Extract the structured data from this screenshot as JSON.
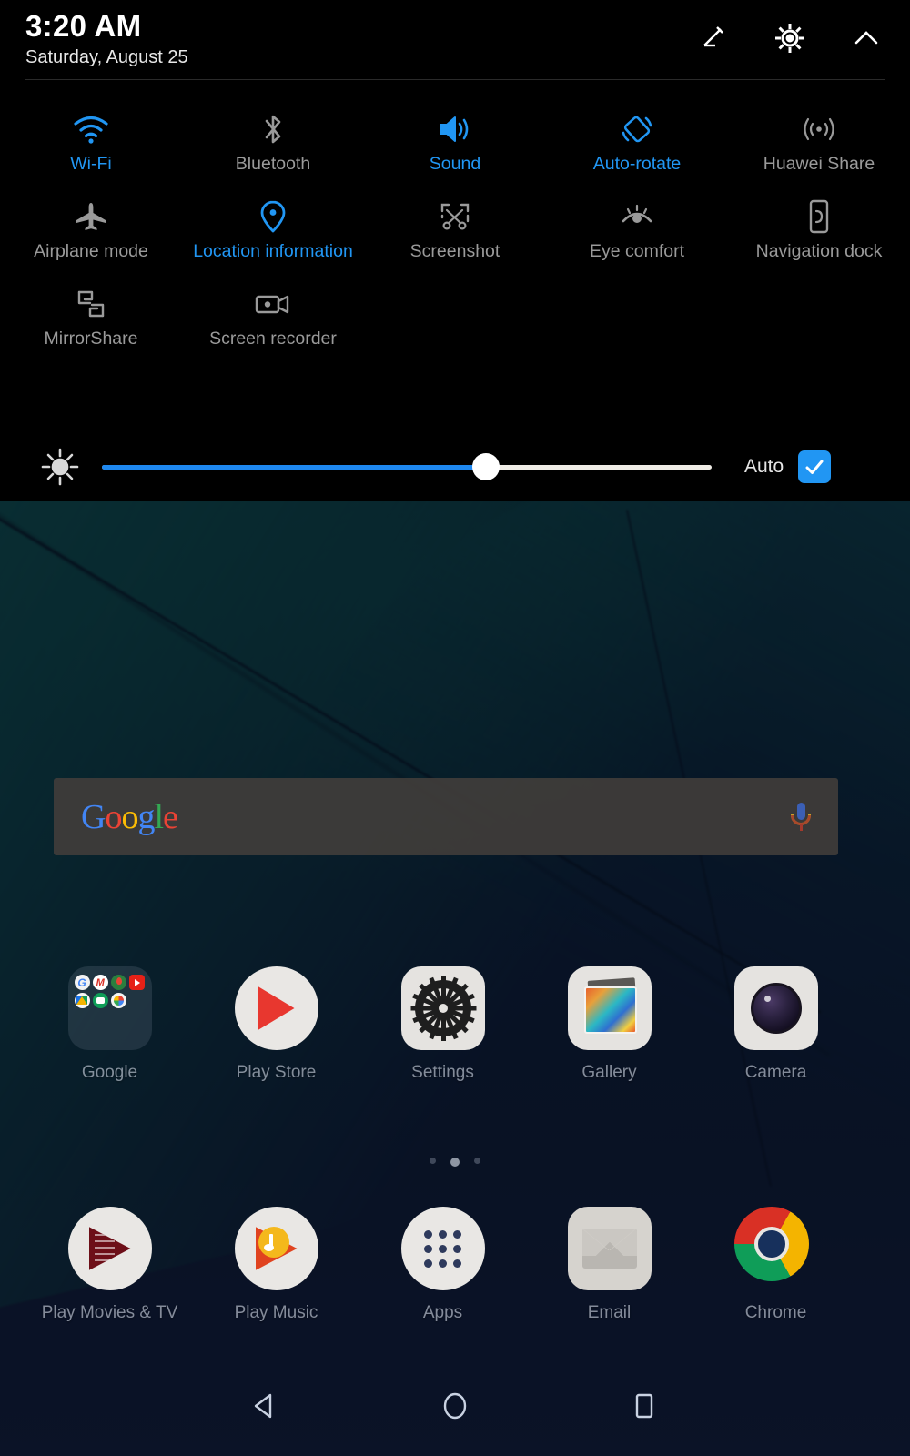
{
  "quick_settings": {
    "time": "3:20 AM",
    "date": "Saturday, August 25",
    "actions": [
      {
        "name": "edit-icon",
        "label": "Edit"
      },
      {
        "name": "settings-gear-icon",
        "label": "Settings"
      },
      {
        "name": "collapse-chevron-up-icon",
        "label": "Collapse"
      }
    ],
    "accent_color": "#2196f3",
    "inactive_color": "#9a9a9a",
    "background_color": "#000000",
    "tiles": [
      {
        "label": "Wi-Fi",
        "icon": "wifi-icon",
        "state": "on"
      },
      {
        "label": "Bluetooth",
        "icon": "bluetooth-icon",
        "state": "off"
      },
      {
        "label": "Sound",
        "icon": "sound-icon",
        "state": "on"
      },
      {
        "label": "Auto-rotate",
        "icon": "auto-rotate-icon",
        "state": "on"
      },
      {
        "label": "Huawei Share",
        "icon": "huawei-share-icon",
        "state": "off"
      },
      {
        "label": "Airplane mode",
        "icon": "airplane-icon",
        "state": "off"
      },
      {
        "label": "Location information",
        "icon": "location-pin-icon",
        "state": "on"
      },
      {
        "label": "Screenshot",
        "icon": "screenshot-icon",
        "state": "off"
      },
      {
        "label": "Eye comfort",
        "icon": "eye-comfort-icon",
        "state": "off"
      },
      {
        "label": "Navigation dock",
        "icon": "navigation-dock-icon",
        "state": "off"
      },
      {
        "label": "MirrorShare",
        "icon": "mirrorshare-icon",
        "state": "off"
      },
      {
        "label": "Screen recorder",
        "icon": "screen-recorder-icon",
        "state": "off"
      }
    ],
    "brightness": {
      "icon": "brightness-sun-icon",
      "value_percent": 63,
      "auto_label": "Auto",
      "auto_checked": true,
      "fill_color": "#1e88f0",
      "track_color": "#efece6"
    }
  },
  "home_screen": {
    "search_widget": {
      "logo_text": "Google",
      "logo_letters": [
        {
          "char": "G",
          "color": "#4285f4"
        },
        {
          "char": "o",
          "color": "#ea4335"
        },
        {
          "char": "o",
          "color": "#fbbc05"
        },
        {
          "char": "g",
          "color": "#4285f4"
        },
        {
          "char": "l",
          "color": "#34a853"
        },
        {
          "char": "e",
          "color": "#ea4335"
        }
      ],
      "mic_icon": "microphone-icon"
    },
    "rows": [
      [
        {
          "label": "Google",
          "icon": "google-folder-icon"
        },
        {
          "label": "Play Store",
          "icon": "play-store-icon"
        },
        {
          "label": "Settings",
          "icon": "settings-app-icon"
        },
        {
          "label": "Gallery",
          "icon": "gallery-app-icon"
        },
        {
          "label": "Camera",
          "icon": "camera-app-icon"
        }
      ],
      [
        {
          "label": "Play Movies & TV",
          "icon": "play-movies-icon"
        },
        {
          "label": "Play Music",
          "icon": "play-music-icon"
        },
        {
          "label": "Apps",
          "icon": "app-drawer-icon"
        },
        {
          "label": "Email",
          "icon": "email-app-icon"
        },
        {
          "label": "Chrome",
          "icon": "chrome-app-icon"
        }
      ]
    ],
    "folder_apps": [
      "Google",
      "Gmail",
      "Maps",
      "YouTube",
      "Drive",
      "Duo",
      "Photos"
    ],
    "page_indicator": {
      "pages": 3,
      "active": 2
    },
    "nav_bar": [
      {
        "name": "nav-back-button",
        "label": "Back"
      },
      {
        "name": "nav-home-button",
        "label": "Home"
      },
      {
        "name": "nav-recents-button",
        "label": "Recents"
      }
    ]
  }
}
